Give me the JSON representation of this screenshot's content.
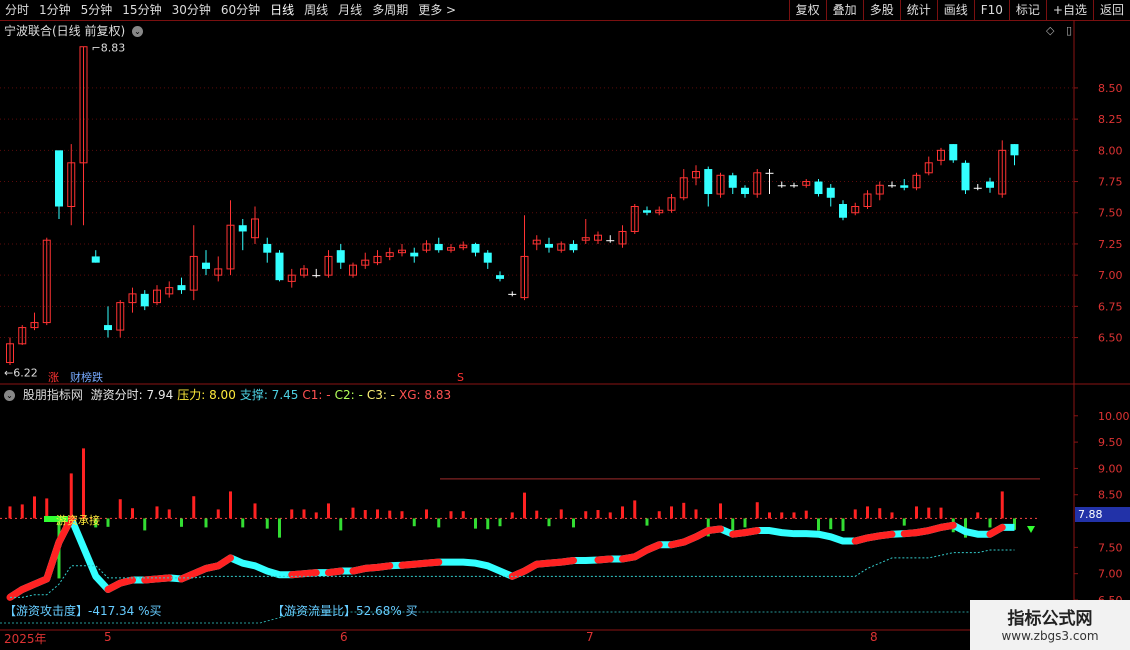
{
  "toolbar": {
    "periods": [
      "分时",
      "1分钟",
      "5分钟",
      "15分钟",
      "30分钟",
      "60分钟",
      "日线",
      "周线",
      "月线",
      "多周期",
      "更多 >"
    ],
    "active_period": "日线",
    "right_buttons": [
      "复权",
      "叠加",
      "多股",
      "统计",
      "画线",
      "F10",
      "标记",
      "+自选",
      "返回"
    ]
  },
  "chart": {
    "title": "宁波联合(日线 前复权)",
    "high_label": "8.83",
    "low_label": "6.22",
    "price_axis": [
      "8.50",
      "8.25",
      "8.00",
      "7.75",
      "7.50",
      "7.25",
      "7.00",
      "6.75",
      "6.50"
    ],
    "markers": {
      "zhang": "涨",
      "caibang": "财榜跌",
      "s": "S"
    }
  },
  "indicator": {
    "name": "股朋指标网",
    "items": [
      {
        "label": "游资分时:",
        "value": "7.94",
        "color": "#e8e8e8"
      },
      {
        "label": "压力:",
        "value": "8.00",
        "color": "#ffeb3b"
      },
      {
        "label": "支撑:",
        "value": "7.45",
        "color": "#4dd0e1"
      },
      {
        "label": "C1:",
        "value": "-",
        "color": "#ff5252"
      },
      {
        "label": "C2:",
        "value": "-",
        "color": "#b2ff59"
      },
      {
        "label": "C3:",
        "value": "-",
        "color": "#fff176"
      },
      {
        "label": "XG:",
        "value": "8.83",
        "color": "#ff5252"
      }
    ],
    "axis": [
      "10.00",
      "9.50",
      "9.00",
      "8.50",
      "7.50",
      "7.00",
      "6.50"
    ],
    "current_tag": "7.88",
    "annot_label": "游资承接",
    "attack": "【游资攻击度】-417.34 %买",
    "flow": "【游资流量比】52.68% 买"
  },
  "dates": {
    "year": "2025年",
    "months": [
      "5",
      "6",
      "7",
      "8"
    ]
  },
  "watermark": {
    "line1": "指标公式网",
    "line2": "www.zbgs3.com"
  },
  "chart_data": {
    "type": "candlestick",
    "series": [
      {
        "values": [
          [
            6.3,
            6.45,
            6.5,
            6.28
          ],
          [
            6.45,
            6.58,
            6.6,
            6.44
          ],
          [
            6.58,
            6.62,
            6.7,
            6.56
          ],
          [
            6.62,
            7.28,
            7.3,
            6.6
          ],
          [
            8.0,
            7.55,
            7.9,
            7.45
          ],
          [
            7.55,
            7.9,
            8.05,
            7.4
          ],
          [
            7.9,
            8.83,
            8.83,
            7.4
          ],
          [
            7.15,
            7.1,
            7.2,
            7.1
          ],
          [
            6.6,
            6.56,
            6.75,
            6.5
          ],
          [
            6.56,
            6.78,
            6.8,
            6.5
          ],
          [
            6.78,
            6.85,
            6.9,
            6.7
          ],
          [
            6.85,
            6.75,
            6.88,
            6.72
          ],
          [
            6.78,
            6.88,
            6.92,
            6.76
          ],
          [
            6.85,
            6.9,
            6.95,
            6.82
          ],
          [
            6.92,
            6.88,
            6.98,
            6.85
          ],
          [
            6.88,
            7.15,
            7.4,
            6.8
          ],
          [
            7.1,
            7.05,
            7.2,
            7.0
          ],
          [
            7.0,
            7.05,
            7.15,
            6.95
          ],
          [
            7.05,
            7.4,
            7.6,
            7.0
          ],
          [
            7.4,
            7.35,
            7.45,
            7.2
          ],
          [
            7.3,
            7.45,
            7.55,
            7.25
          ],
          [
            7.25,
            7.18,
            7.3,
            7.1
          ],
          [
            7.18,
            6.96,
            7.2,
            6.95
          ],
          [
            6.95,
            7.0,
            7.05,
            6.9
          ],
          [
            7.0,
            7.05,
            7.08,
            6.98
          ],
          [
            7.0,
            7.0,
            7.05,
            6.98
          ],
          [
            7.0,
            7.15,
            7.2,
            6.98
          ],
          [
            7.2,
            7.1,
            7.25,
            7.05
          ],
          [
            7.0,
            7.08,
            7.1,
            6.98
          ],
          [
            7.08,
            7.12,
            7.18,
            7.05
          ],
          [
            7.1,
            7.15,
            7.2,
            7.08
          ],
          [
            7.15,
            7.18,
            7.22,
            7.12
          ],
          [
            7.18,
            7.2,
            7.25,
            7.15
          ],
          [
            7.18,
            7.15,
            7.22,
            7.1
          ],
          [
            7.2,
            7.25,
            7.28,
            7.18
          ],
          [
            7.25,
            7.2,
            7.3,
            7.18
          ],
          [
            7.2,
            7.22,
            7.25,
            7.18
          ],
          [
            7.22,
            7.24,
            7.27,
            7.2
          ],
          [
            7.25,
            7.18,
            7.26,
            7.15
          ],
          [
            7.18,
            7.1,
            7.2,
            7.05
          ],
          [
            7.0,
            6.97,
            7.03,
            6.95
          ],
          [
            6.85,
            6.85,
            6.87,
            6.83
          ],
          [
            6.82,
            7.15,
            7.48,
            6.8
          ],
          [
            7.25,
            7.28,
            7.32,
            7.2
          ],
          [
            7.25,
            7.22,
            7.3,
            7.18
          ],
          [
            7.2,
            7.25,
            7.27,
            7.18
          ],
          [
            7.25,
            7.2,
            7.28,
            7.18
          ],
          [
            7.28,
            7.3,
            7.45,
            7.25
          ],
          [
            7.28,
            7.32,
            7.35,
            7.25
          ],
          [
            7.28,
            7.28,
            7.32,
            7.26
          ],
          [
            7.25,
            7.35,
            7.4,
            7.22
          ],
          [
            7.35,
            7.55,
            7.57,
            7.33
          ],
          [
            7.52,
            7.5,
            7.55,
            7.48
          ],
          [
            7.5,
            7.52,
            7.55,
            7.48
          ],
          [
            7.52,
            7.62,
            7.65,
            7.5
          ],
          [
            7.62,
            7.78,
            7.85,
            7.6
          ],
          [
            7.78,
            7.83,
            7.88,
            7.72
          ],
          [
            7.85,
            7.65,
            7.87,
            7.55
          ],
          [
            7.65,
            7.8,
            7.82,
            7.62
          ],
          [
            7.8,
            7.7,
            7.82,
            7.65
          ],
          [
            7.7,
            7.65,
            7.72,
            7.62
          ],
          [
            7.65,
            7.82,
            7.85,
            7.62
          ],
          [
            7.82,
            7.82,
            7.85,
            7.65
          ],
          [
            7.72,
            7.72,
            7.75,
            7.7
          ],
          [
            7.72,
            7.72,
            7.74,
            7.7
          ],
          [
            7.72,
            7.75,
            7.77,
            7.7
          ],
          [
            7.75,
            7.65,
            7.77,
            7.63
          ],
          [
            7.7,
            7.62,
            7.73,
            7.55
          ],
          [
            7.57,
            7.46,
            7.6,
            7.44
          ],
          [
            7.5,
            7.55,
            7.58,
            7.48
          ],
          [
            7.55,
            7.65,
            7.68,
            7.53
          ],
          [
            7.65,
            7.72,
            7.75,
            7.6
          ],
          [
            7.72,
            7.72,
            7.75,
            7.7
          ],
          [
            7.72,
            7.7,
            7.77,
            7.68
          ],
          [
            7.7,
            7.8,
            7.82,
            7.68
          ],
          [
            7.82,
            7.9,
            7.95,
            7.8
          ],
          [
            7.92,
            8.0,
            8.02,
            7.88
          ],
          [
            8.05,
            7.92,
            8.05,
            7.9
          ],
          [
            7.9,
            7.68,
            7.92,
            7.65
          ],
          [
            7.7,
            7.7,
            7.73,
            7.68
          ],
          [
            7.75,
            7.7,
            7.78,
            7.66
          ],
          [
            7.65,
            8.0,
            8.08,
            7.62
          ],
          [
            8.05,
            7.96,
            8.05,
            7.88
          ]
        ]
      }
    ],
    "ylim": [
      6.2,
      8.9
    ],
    "indicator_ylim": [
      6.5,
      10.3
    ]
  }
}
